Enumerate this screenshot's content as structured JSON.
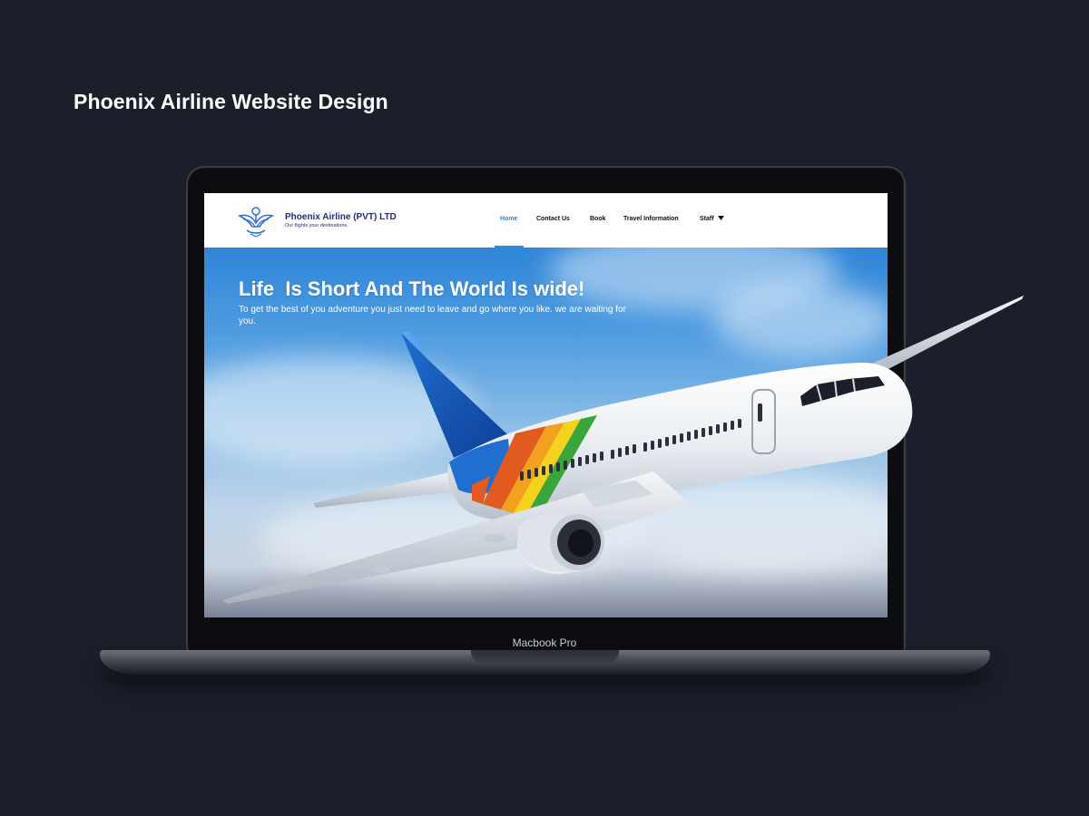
{
  "page": {
    "title": "Phoenix Airline Website Design"
  },
  "device": {
    "label": "Macbook Pro"
  },
  "website": {
    "logo": {
      "name": "Phoenix Airline (PVT) LTD",
      "tagline": "Our flights your destinations."
    },
    "nav": [
      {
        "label": "Home",
        "active": true
      },
      {
        "label": "Contact Us",
        "active": false
      },
      {
        "label": "Book",
        "active": false
      },
      {
        "label": "Travel Information",
        "active": false
      },
      {
        "label": "Staff",
        "active": false,
        "has_dropdown": true
      }
    ],
    "hero": {
      "headline": "Life  Is Short And The World Is wide!",
      "subtext": "To get the best of you adventure you just need to leave and go where you like. we are waiting for you."
    }
  },
  "colors": {
    "background": "#1b1f2a",
    "accent": "#2a8ae0",
    "brand_blue": "#1b2d8f",
    "sky": "#4d9ae0"
  },
  "icons": [
    "phoenix-logo-icon",
    "dropdown-caret-icon",
    "airplane-illustration"
  ]
}
